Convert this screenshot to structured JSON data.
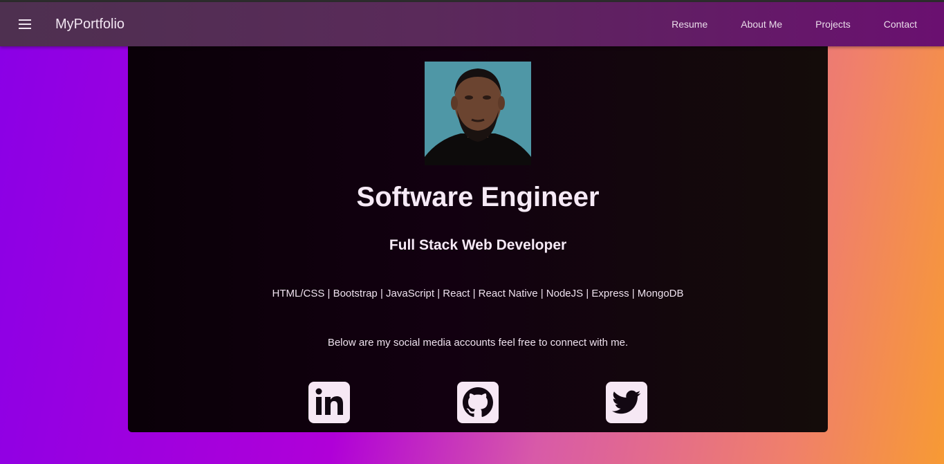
{
  "navbar": {
    "menu_icon": "hamburger-menu-icon",
    "brand": "MyPortfolio",
    "links": [
      "Resume",
      "About Me",
      "Projects",
      "Contact"
    ]
  },
  "profile": {
    "title": "Software Engineer",
    "subtitle": "Full Stack Web Developer",
    "skills": "HTML/CSS | Bootstrap | JavaScript | React | React Native | NodeJS | Express | MongoDB",
    "social_text": "Below are my social media accounts feel free to connect with me.",
    "social_icons": [
      "linkedin-icon",
      "github-icon",
      "twitter-icon"
    ]
  },
  "colors": {
    "navbar": "#5a2a5a",
    "card": "#0e000c",
    "icon_bg": "#f6e8f4",
    "background_left": "#8a00e6",
    "background_right": "#f79a34"
  }
}
